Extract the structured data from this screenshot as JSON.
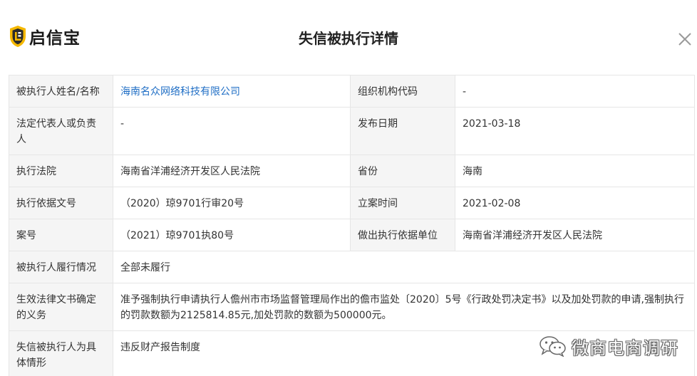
{
  "header": {
    "brand": "启信宝",
    "title": "失信被执行详情"
  },
  "colors": {
    "logo_yellow": "#f5b800",
    "logo_dark": "#2b2b2b",
    "link_blue": "#1f6ec5",
    "label_bg": "#f5f5f5",
    "border": "#e6e6e6"
  },
  "icons": {
    "close": "close-icon",
    "logo": "shield-logo-icon",
    "watermark": "wechat-icon"
  },
  "details": {
    "name_label": "被执行人姓名/名称",
    "name_value": "海南名众网络科技有限公司",
    "org_code_label": "组织机构代码",
    "org_code_value": "-",
    "legal_rep_label": "法定代表人或负责人",
    "legal_rep_value": "-",
    "publish_date_label": "发布日期",
    "publish_date_value": "2021-03-18",
    "court_label": "执行法院",
    "court_value": "海南省洋浦经济开发区人民法院",
    "province_label": "省份",
    "province_value": "海南",
    "basis_doc_label": "执行依据文号",
    "basis_doc_value": "（2020）琼9701行审20号",
    "filing_time_label": "立案时间",
    "filing_time_value": "2021-02-08",
    "case_no_label": "案号",
    "case_no_value": "（2021）琼9701执80号",
    "basis_unit_label": "做出执行依据单位",
    "basis_unit_value": "海南省洋浦经济开发区人民法院",
    "performance_label": "被执行人履行情况",
    "performance_value": "全部未履行",
    "obligation_label": "生效法律文书确定的义务",
    "obligation_value": "准予强制执行申请执行人儋州市市场监督管理局作出的儋市监处〔2020〕5号《行政处罚决定书》以及加处罚款的申请,强制执行的罚款数额为2125814.85元,加处罚款的数额为500000元。",
    "circumstance_label": "失信被执行人为具体情形",
    "circumstance_value": "违反财产报告制度"
  },
  "watermark": {
    "text": "微商电商调研"
  }
}
